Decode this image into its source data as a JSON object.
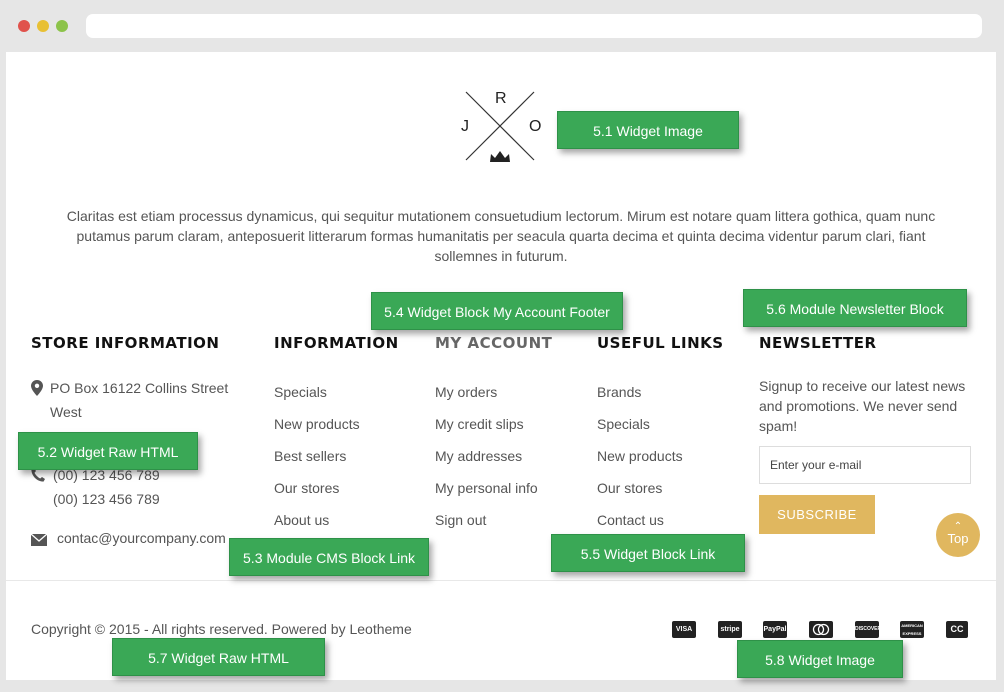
{
  "logo": {
    "letters": {
      "top": "R",
      "left": "J",
      "right": "O"
    }
  },
  "about_text": "Claritas est etiam processus dynamicus, qui sequitur mutationem consuetudium lectorum. Mirum est notare quam littera gothica, quam nunc putamus parum claram, anteposuerit litterarum formas humanitatis per seacula quarta decima et quinta decima videntur parum clari, fiant sollemnes in futurum.",
  "store": {
    "title": "STORE INFORMATION",
    "address_line1": "PO Box 16122 Collins Street",
    "address_line2": "West",
    "phone1": "(00) 123 456 789",
    "phone2": "(00) 123 456 789",
    "email": "contac@yourcompany.com"
  },
  "information": {
    "title": "INFORMATION",
    "links": [
      "Specials",
      "New products",
      "Best sellers",
      "Our stores",
      "About us"
    ]
  },
  "my_account": {
    "title": "MY ACCOUNT",
    "links": [
      "My orders",
      "My credit slips",
      "My addresses",
      "My personal info",
      "Sign out"
    ]
  },
  "useful_links": {
    "title": "USEFUL LINKS",
    "links": [
      "Brands",
      "Specials",
      "New products",
      "Our stores",
      "Contact us"
    ]
  },
  "newsletter": {
    "title": "NEWSLETTER",
    "text": "Signup to receive our latest news and promotions. We never send spam!",
    "placeholder": "Enter your e-mail",
    "button": "SUBSCRIBE"
  },
  "top_button": "Top",
  "copyright": "Copyright © 2015 - All rights reserved. Powered by Leotheme",
  "payments": [
    "VISA",
    "stripe",
    "PayPal",
    "mastercard-icon",
    "DISCOVER",
    "AMERICAN EXPRESS",
    "CC"
  ],
  "annotations": {
    "a51": "5.1 Widget Image",
    "a52": "5.2 Widget Raw HTML",
    "a53": "5.3 Module CMS Block Link",
    "a54": "5.4 Widget Block My Account Footer",
    "a55": "5.5 Widget Block Link",
    "a56": "5.6 Module Newsletter Block",
    "a57": "5.7 Widget Raw HTML",
    "a58": "5.8 Widget Image"
  },
  "colors": {
    "annotation_green": "#3aa856",
    "accent_gold": "#e0b75f",
    "heading": "#111111"
  }
}
